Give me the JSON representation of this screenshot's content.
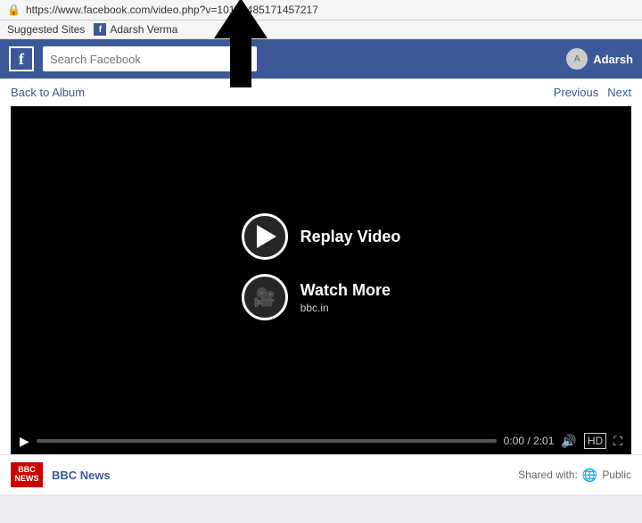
{
  "browser": {
    "url": "https://www.facebook.com/video.php?v=10152485171457217",
    "lock_symbol": "🔒",
    "bookmarks_label": "Suggested Sites",
    "fb_bookmark_label": "f",
    "user_bookmark": "Adarsh Verma"
  },
  "navbar": {
    "fb_logo": "f",
    "search_placeholder": "Search Facebook",
    "user_name": "Adarsh",
    "user_avatar_text": "A"
  },
  "page": {
    "back_link": "Back to Album",
    "previous": "Previous",
    "next": "Next"
  },
  "video": {
    "replay_label": "Replay Video",
    "watch_more_label": "Watch More",
    "watch_more_sub": "bbc.in",
    "time_current": "0:00",
    "time_total": "2:01",
    "hd_label": "HD"
  },
  "post": {
    "source_name": "BBC News",
    "news_line1": "BBC",
    "news_line2": "NEWS",
    "shared_label": "Shared with:",
    "public_label": "Public"
  },
  "annotation": {
    "arrow_label": "annotation arrow pointing up"
  }
}
